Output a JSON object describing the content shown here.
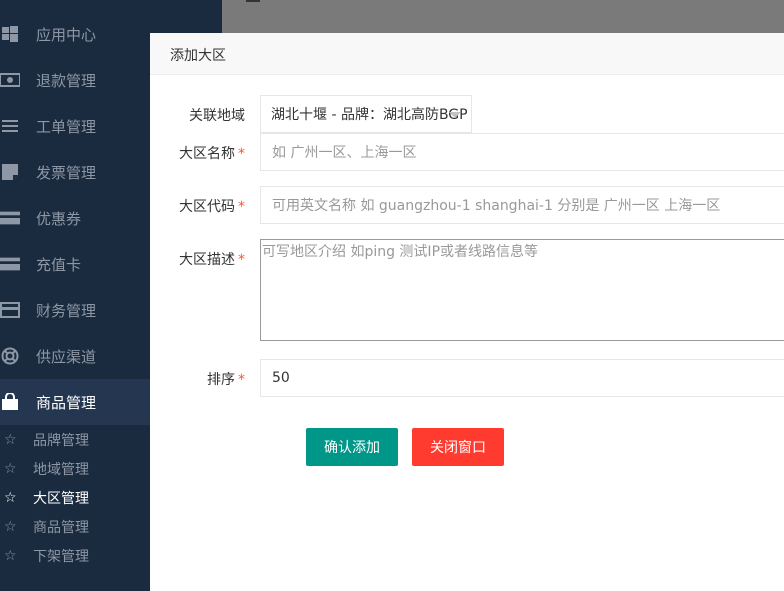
{
  "sidebar": {
    "items": [
      {
        "label": "应用中心",
        "icon": "windows-icon"
      },
      {
        "label": "退款管理",
        "icon": "money-icon"
      },
      {
        "label": "工单管理",
        "icon": "list-icon"
      },
      {
        "label": "发票管理",
        "icon": "file-icon"
      },
      {
        "label": "优惠券",
        "icon": "card-icon"
      },
      {
        "label": "充值卡",
        "icon": "card-icon"
      },
      {
        "label": "财务管理",
        "icon": "credit-card-icon"
      },
      {
        "label": "供应渠道",
        "icon": "lifebuoy-icon"
      },
      {
        "label": "商品管理",
        "icon": "shopping-bag-icon"
      }
    ],
    "subitems": [
      {
        "label": "品牌管理"
      },
      {
        "label": "地域管理"
      },
      {
        "label": "大区管理"
      },
      {
        "label": "商品管理"
      },
      {
        "label": "下架管理"
      }
    ],
    "star_glyph": "☆"
  },
  "dialog": {
    "title": "添加大区",
    "fields": {
      "region": {
        "label": "关联地域",
        "value": "湖北十堰 - 品牌：湖北高防BGP"
      },
      "name": {
        "label": "大区名称",
        "placeholder": "如 广州一区、上海一区"
      },
      "code": {
        "label": "大区代码",
        "placeholder": "可用英文名称 如 guangzhou-1 shanghai-1  分别是 广州一区 上海一区"
      },
      "desc": {
        "label": "大区描述",
        "placeholder": "可写地区介绍 如ping 测试IP或者线路信息等"
      },
      "sort": {
        "label": "排序",
        "value": "50"
      }
    },
    "required_mark": "*",
    "buttons": {
      "confirm": "确认添加",
      "close": "关闭窗口"
    }
  },
  "colors": {
    "sidebar_bg": "#1a2a3f",
    "confirm": "#009688",
    "close": "#ff3b30",
    "required": "#ff5722"
  }
}
